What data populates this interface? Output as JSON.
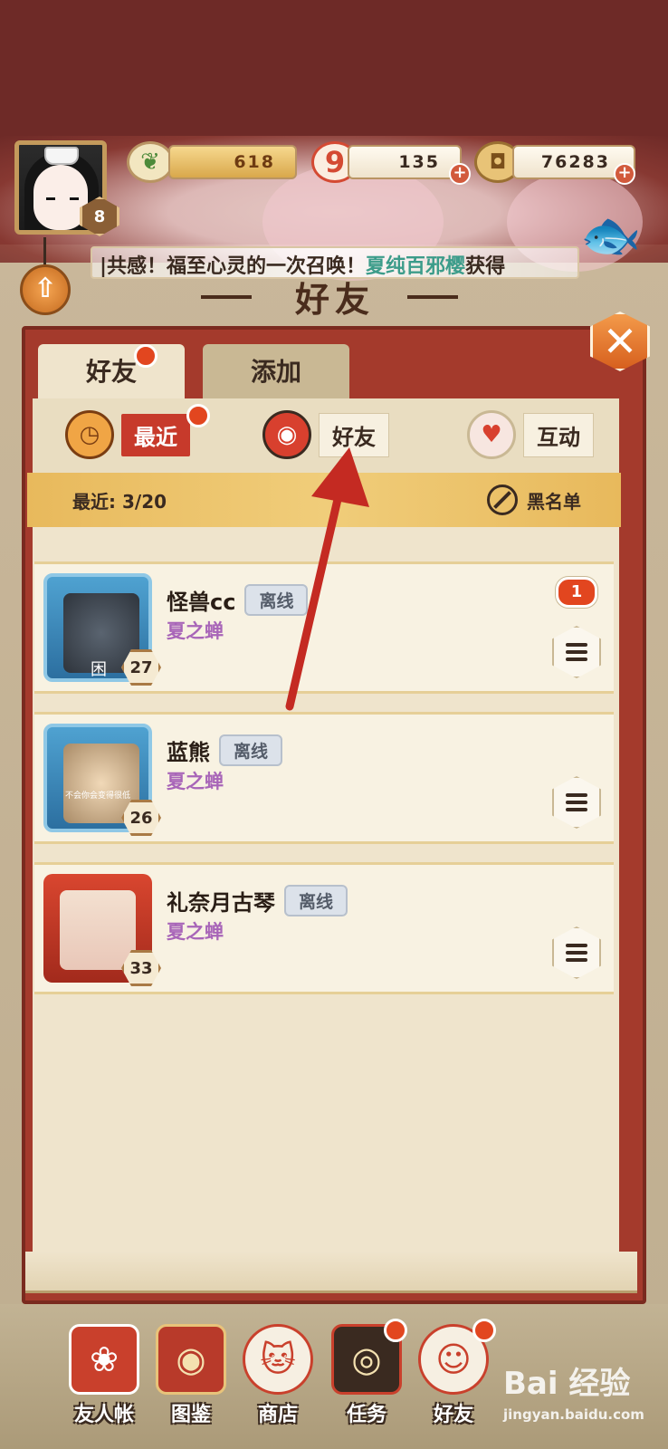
{
  "hud": {
    "level": "8",
    "jade": "618",
    "stamina": "135",
    "coins": "76283",
    "plus": "+",
    "ticker_prefix": "|共感！福至心灵的一次召唤！",
    "ticker_highlight": "夏纯百邪樱",
    "ticker_suffix": "获得",
    "page_title": "好友",
    "close": "✕",
    "up_arrow": "⇧"
  },
  "tabs": [
    {
      "label": "好友",
      "active": true
    },
    {
      "label": "添加",
      "active": false
    }
  ],
  "subtabs": [
    {
      "label": "最近",
      "icon": "clock-icon"
    },
    {
      "label": "好友",
      "icon": "daruma-icon"
    },
    {
      "label": "互动",
      "icon": "gift-icon"
    }
  ],
  "recent": {
    "label": "最近:",
    "count": "3/20",
    "blacklist": "黑名单"
  },
  "friends": [
    {
      "name": "怪兽cc",
      "status": "离线",
      "guild": "夏之蝉",
      "level": "27",
      "unread": "1",
      "avatar_caption": "困"
    },
    {
      "name": "蓝熊",
      "status": "离线",
      "guild": "夏之蝉",
      "level": "26",
      "unread": "",
      "avatar_caption": "不会你会变得很低"
    },
    {
      "name": "礼奈月古琴",
      "status": "离线",
      "guild": "夏之蝉",
      "level": "33",
      "unread": "",
      "avatar_caption": ""
    }
  ],
  "nav": [
    {
      "label": "友人帐",
      "icon": "book-icon"
    },
    {
      "label": "图鉴",
      "icon": "eye-scroll-icon"
    },
    {
      "label": "商店",
      "icon": "lucky-cat-icon"
    },
    {
      "label": "任务",
      "icon": "target-icon"
    },
    {
      "label": "好友",
      "icon": "friends-doll-icon"
    }
  ],
  "watermark": {
    "big": "Bai 经验",
    "small": "jingyan.baidu.com"
  },
  "colors": {
    "accent_red": "#c73a2b",
    "panel_red": "#a43a2c",
    "guild_purple": "#a865b8",
    "highlight_teal": "#3c9c8a",
    "badge_red": "#e2461f"
  }
}
